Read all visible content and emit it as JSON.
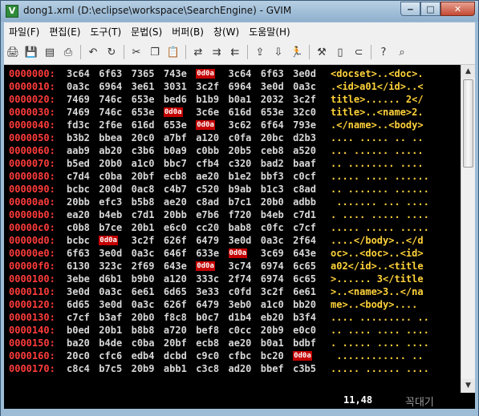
{
  "window": {
    "title": "dong1.xml (D:\\eclipse\\workspace\\SearchEngine) - GVIM",
    "icon_label": "V"
  },
  "menu": [
    "파일(F)",
    "편집(E)",
    "도구(T)",
    "문법(S)",
    "버퍼(B)",
    "창(W)",
    "도움말(H)"
  ],
  "toolbar": {
    "icons": [
      "open-icon",
      "save-icon",
      "save-all-icon",
      "print-icon",
      "undo-icon",
      "redo-icon",
      "cut-icon",
      "copy-icon",
      "paste-icon",
      "replace-icon",
      "find-next-icon",
      "find-prev-icon",
      "load-session-icon",
      "save-session-icon",
      "run-script-icon",
      "make-icon",
      "shell-icon",
      "ctags-icon",
      "help-icon",
      "find-help-icon"
    ],
    "glyphs": {
      "open": "🖨",
      "save": "💾",
      "save_all": "▤",
      "print": "⎙",
      "undo": "↶",
      "redo": "↻",
      "cut": "✂",
      "copy": "❐",
      "paste": "📋",
      "replace": "⇄",
      "find_next": "⇉",
      "find_prev": "⇇",
      "load_session": "⇪",
      "save_session": "⇩",
      "run_script": "🏃",
      "make": "⚒",
      "shell": "▯",
      "ctags": "⊂",
      "help": "?",
      "find_help": "⌕"
    }
  },
  "hex_lines": [
    {
      "addr": "0000000:",
      "words": [
        "3c64",
        "6f63",
        "7365",
        "743e",
        "0d0a",
        "3c64",
        "6f63",
        "3e0d"
      ],
      "ascii": "<docset>..<doc>."
    },
    {
      "addr": "0000010:",
      "words": [
        "0a3c",
        "6964",
        "3e61",
        "3031",
        "3c2f",
        "6964",
        "3e0d",
        "0a3c"
      ],
      "ascii": ".<id>a01</id>..<"
    },
    {
      "addr": "0000020:",
      "words": [
        "7469",
        "746c",
        "653e",
        "bed6",
        "b1b9",
        "b0a1",
        "2032",
        "3c2f"
      ],
      "ascii": "title>...... 2</"
    },
    {
      "addr": "0000030:",
      "words": [
        "7469",
        "746c",
        "653e",
        "0d0a",
        "3c6e",
        "616d",
        "653e",
        "32c0"
      ],
      "ascii": "title>..<name>2."
    },
    {
      "addr": "0000040:",
      "words": [
        "fd3c",
        "2f6e",
        "616d",
        "653e",
        "0d0a",
        "3c62",
        "6f64",
        "793e"
      ],
      "ascii": ".</name>..<body>"
    },
    {
      "addr": "0000050:",
      "words": [
        "b3b2",
        "bbea",
        "20c0",
        "a7bf",
        "a120",
        "c0fa",
        "20bc",
        "d2b3"
      ],
      "ascii": ".... ..... .. .."
    },
    {
      "addr": "0000060:",
      "words": [
        "aab9",
        "ab20",
        "c3b6",
        "b0a9",
        "c0bb",
        "20b5",
        "ceb8",
        "a520"
      ],
      "ascii": "... ...... ..... "
    },
    {
      "addr": "0000070:",
      "words": [
        "b5ed",
        "20b0",
        "a1c0",
        "bbc7",
        "cfb4",
        "c320",
        "bad2",
        "baaf"
      ],
      "ascii": ".. ........ ...."
    },
    {
      "addr": "0000080:",
      "words": [
        "c7d4",
        "c0ba",
        "20bf",
        "ecb8",
        "ae20",
        "b1e2",
        "bbf3",
        "c0cf"
      ],
      "ascii": "..... .... ......"
    },
    {
      "addr": "0000090:",
      "words": [
        "bcbc",
        "200d",
        "0ac8",
        "c4b7",
        "c520",
        "b9ab",
        "b1c3",
        "c8ad"
      ],
      "ascii": ".. ....... ......"
    },
    {
      "addr": "00000a0:",
      "words": [
        "20bb",
        "efc3",
        "b5b8",
        "ae20",
        "c8ad",
        "b7c1",
        "20b0",
        "adbb"
      ],
      "ascii": " ....... ... ...."
    },
    {
      "addr": "00000b0:",
      "words": [
        "ea20",
        "b4eb",
        "c7d1",
        "20bb",
        "e7b6",
        "f720",
        "b4eb",
        "c7d1"
      ],
      "ascii": ". .... ..... ...."
    },
    {
      "addr": "00000c0:",
      "words": [
        "c0b8",
        "b7ce",
        "20b1",
        "e6c0",
        "cc20",
        "bab8",
        "c0fc",
        "c7cf"
      ],
      "ascii": "..... ..... ....."
    },
    {
      "addr": "00000d0:",
      "words": [
        "bcbc",
        "0d0a",
        "3c2f",
        "626f",
        "6479",
        "3e0d",
        "0a3c",
        "2f64"
      ],
      "ascii": "....</body>..</d"
    },
    {
      "addr": "00000e0:",
      "words": [
        "6f63",
        "3e0d",
        "0a3c",
        "646f",
        "633e",
        "0d0a",
        "3c69",
        "643e"
      ],
      "ascii": "oc>..<doc>..<id>"
    },
    {
      "addr": "00000f0:",
      "words": [
        "6130",
        "323c",
        "2f69",
        "643e",
        "0d0a",
        "3c74",
        "6974",
        "6c65"
      ],
      "ascii": "a02</id>..<title"
    },
    {
      "addr": "0000100:",
      "words": [
        "3ebe",
        "d6b1",
        "b9b0",
        "a120",
        "333c",
        "2f74",
        "6974",
        "6c65"
      ],
      "ascii": ">...... 3</title"
    },
    {
      "addr": "0000110:",
      "words": [
        "3e0d",
        "0a3c",
        "6e61",
        "6d65",
        "3e33",
        "c0fd",
        "3c2f",
        "6e61"
      ],
      "ascii": ">..<name>3..</na"
    },
    {
      "addr": "0000120:",
      "words": [
        "6d65",
        "3e0d",
        "0a3c",
        "626f",
        "6479",
        "3eb0",
        "a1c0",
        "bb20"
      ],
      "ascii": "me>..<body>.... "
    },
    {
      "addr": "0000130:",
      "words": [
        "c7cf",
        "b3af",
        "20b0",
        "f8c8",
        "b0c7",
        "d1b4",
        "eb20",
        "b3f4"
      ],
      "ascii": ".... ......... .."
    },
    {
      "addr": "0000140:",
      "words": [
        "b0ed",
        "20b1",
        "b8b8",
        "a720",
        "bef8",
        "c0cc",
        "20b9",
        "e0c0"
      ],
      "ascii": ".. .... .... ...."
    },
    {
      "addr": "0000150:",
      "words": [
        "ba20",
        "b4de",
        "c0ba",
        "20bf",
        "ecb8",
        "ae20",
        "b0a1",
        "bdbf"
      ],
      "ascii": ". ..... .... ...."
    },
    {
      "addr": "0000160:",
      "words": [
        "20c0",
        "cfc6",
        "edb4",
        "dcbd",
        "c9c0",
        "cfbc",
        "bc20",
        "0d0a"
      ],
      "ascii": " ............ .."
    },
    {
      "addr": "0000170:",
      "words": [
        "c8c4",
        "b7c5",
        "20b9",
        "abb1",
        "c3c8",
        "ad20",
        "bbef",
        "c3b5"
      ],
      "ascii": "..... ...... ...."
    }
  ],
  "highlight": "0d0a",
  "status": {
    "position": "11,48",
    "mode": "꼭대기"
  }
}
